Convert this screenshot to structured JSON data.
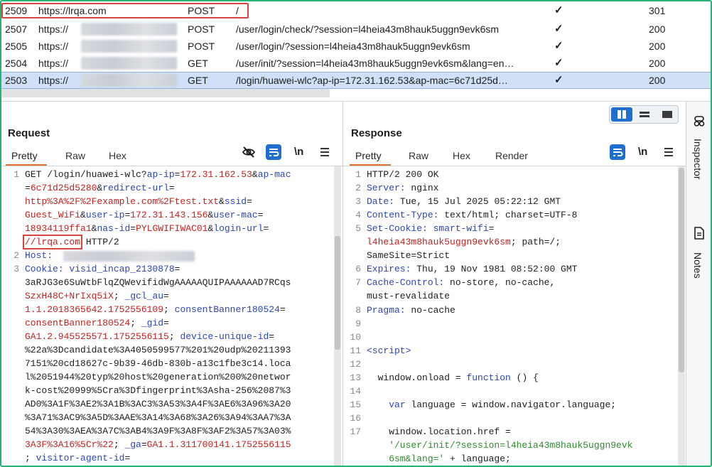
{
  "history": {
    "rows": [
      {
        "num": "2509",
        "host": "https://lrqa.com",
        "method": "POST",
        "url": "/",
        "edited": "",
        "status": "301"
      },
      {
        "num": "2507",
        "host": "https://",
        "method": "POST",
        "url": "/user/login/check/?session=l4heia43m8hauk5uggn9evk6sm",
        "edited": "✓",
        "status": "200"
      },
      {
        "num": "2505",
        "host": "https://",
        "method": "POST",
        "url": "/user/login/?session=l4heia43m8hauk5uggn9evk6sm",
        "edited": "✓",
        "status": "200"
      },
      {
        "num": "2504",
        "host": "https://",
        "method": "GET",
        "url": "/user/init/?session=l4heia43m8hauk5uggn9evk6sm&lang=en…",
        "edited": "✓",
        "status": "200"
      },
      {
        "num": "2503",
        "host": "https://",
        "method": "GET",
        "url": "/login/huawei-wlc?ap-ip=172.31.162.53&ap-mac=6c71d25d…",
        "edited": "✓",
        "status": "200"
      }
    ],
    "first_row_check": "✓"
  },
  "request": {
    "title": "Request",
    "tabs": [
      "Pretty",
      "Raw",
      "Hex"
    ],
    "lines": {
      "l1a_pre": "GET /login/huawei-wlc?",
      "l1a_k1": "ap-ip",
      "l1a_eq1": "=",
      "l1a_v1": "172.31.162.53",
      "l1a_amp1": "&",
      "l1a_k2": "ap-mac",
      "l1b_eq": "=",
      "l1b_v": "6c71d25d5280",
      "l1b_amp": "&",
      "l1b_k": "redirect-url",
      "l1b_eq2": "=",
      "l1c_v": "http%3A%2F%2Fexample.com%2Ftest.txt",
      "l1c_amp": "&",
      "l1c_k": "ssid",
      "l1c_eq": "=",
      "l1d_v1": "Guest_WiFi",
      "l1d_amp1": "&",
      "l1d_k1": "user-ip",
      "l1d_eq1": "=",
      "l1d_v2": "172.31.143.156",
      "l1d_amp2": "&",
      "l1d_k2": "user-mac",
      "l1d_eq2": "=",
      "l1e_v1": "18934119ffa1",
      "l1e_amp1": "&",
      "l1e_k1": "nas-id",
      "l1e_eq1": "=",
      "l1e_v2": "PYLGWIFIWAC01",
      "l1e_amp2": "&",
      "l1e_k2": "login-url",
      "l1e_eq2": "=",
      "l1f_v": "//lrqa.com",
      "l1f_proto": " HTTP/2",
      "l2_k": "Host:",
      "l3_k": "Cookie:",
      "l3a_k": " visid_incap_2130878",
      "l3a_eq": "=",
      "c1": "3aRJG3e6SuWtbFlqZQWevifidWgAAAAAQUIPAAAAAAD7RCqs",
      "c2": "SzxH48C+NrIxq5iX",
      "c2_sep": "; ",
      "c2_k": "_gcl_au",
      "c2_eq": "=",
      "c3": "1.1.2018365642.1752556109",
      "c3_sep": "; ",
      "c3_k": "consentBanner180524",
      "c3_eq": "=",
      "c4": "consentBanner180524",
      "c4_sep": "; ",
      "c4_k": "_gid",
      "c4_eq": "=",
      "c5": "GA1.2.945525571.1752556115",
      "c5_sep": "; ",
      "c5_k": "device-unique-id",
      "c5_eq": "=",
      "c6": "%22a%3Dcandidate%3A4050599577%201%20udp%20211393",
      "c7": "7151%20cd18627c-9b39-46db-830b-a13c1fbe3c14.loca",
      "c8": "l%2051944%20typ%20host%20generation%200%20networ",
      "c9": "k-cost%20999%5Cra%3Dfingerprint%3Asha-256%2087%3",
      "c10": "AD0%3A1F%3AE2%3A1B%3AC3%3A53%3A4F%3AE6%3A96%3A20",
      "c11": "%3A71%3AC9%3A5D%3AAE%3A14%3A68%3A26%3A94%3AA7%3A",
      "c12": "54%3A30%3AEA%3A7C%3AB4%3A9F%3A8F%3AF2%3A57%3A03%",
      "c13": "3A3F%3A16%5Cr%22",
      "c13_sep": "; ",
      "c13_k": "_ga",
      "c13_eq": "=",
      "c13_v": "GA1.1.311700141.1752556115",
      "c14_sep": "; ",
      "c14_k": "visitor-agent-id",
      "c14_eq": "="
    },
    "line_numbers": [
      "1",
      "2",
      "3"
    ]
  },
  "response": {
    "title": "Response",
    "tabs": [
      "Pretty",
      "Raw",
      "Hex",
      "Render"
    ],
    "lines": {
      "r1": "HTTP/2 200 OK",
      "r2_k": "Server:",
      "r2_v": " nginx",
      "r3_k": "Date:",
      "r3_v": " Tue, 15 Jul 2025 05:22:12 GMT",
      "r4_k": "Content-Type:",
      "r4_v": " text/html; charset=UTF-8",
      "r5_k": "Set-Cookie:",
      "r5_v1": " smart-wifi",
      "r5_eq": "=",
      "r5b_v": "l4heia43m8hauk5uggn9evk6sm",
      "r5b_rest": "; path=/;",
      "r5c": "SameSite=Strict",
      "r6_k": "Expires:",
      "r6_v": " Thu, 19 Nov 1981 08:52:00 GMT",
      "r7_k": "Cache-Control:",
      "r7_v": " no-store, no-cache,",
      "r7b": "must-revalidate",
      "r8_k": "Pragma:",
      "r8_v": " no-cache",
      "r11": "<script>",
      "r13_a": "  window.onload = ",
      "r13_b": "function",
      "r13_c": " () {",
      "r15_a": "    ",
      "r15_b": "var",
      "r15_c": " language = window.navigator.language;",
      "r17": "    window.location.href =",
      "r17b": "    '/user/init/?session=l4heia43m8hauk5uggn9evk",
      "r17c_a": "    6sm&lang='",
      "r17c_b": " + language;"
    },
    "line_numbers": [
      "1",
      "2",
      "3",
      "4",
      "5",
      "6",
      "7",
      "8",
      "9",
      "10",
      "11",
      "12",
      "13",
      "14",
      "15",
      "16",
      "17"
    ]
  },
  "sidebar": {
    "inspector_label": "Inspector",
    "notes_label": "Notes"
  },
  "colors": {
    "frame": "#22b573",
    "selected_row": "#cfe0f7",
    "highlight_box": "#d9443f",
    "accent_blue": "#1f6fd1",
    "tab_underline": "#e0732c",
    "param_name": "#2c46b5",
    "param_value": "#c5221f"
  }
}
